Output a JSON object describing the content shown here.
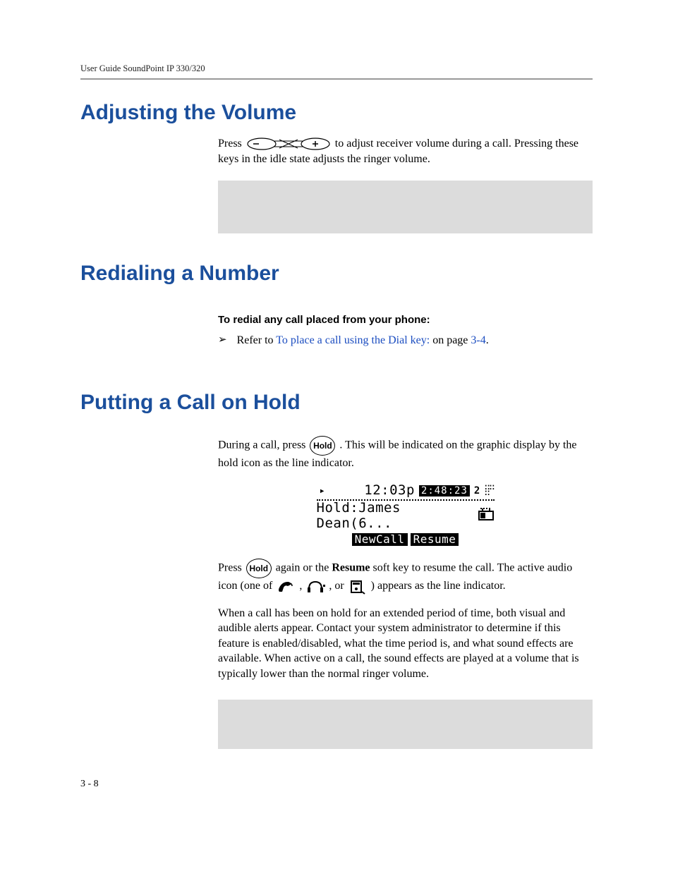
{
  "header": {
    "guide_title": "User Guide SoundPoint IP 330/320"
  },
  "sections": {
    "adjusting_volume": {
      "title": "Adjusting the Volume",
      "p1a": "Press ",
      "p1b": " to adjust receiver volume during a call. Pressing these keys in the idle state adjusts the ringer volume."
    },
    "redialing": {
      "title": "Redialing a Number",
      "subhead": "To redial any call placed from your phone:",
      "bullet_pre": "Refer to ",
      "bullet_link": "To place a call using the Dial key:",
      "bullet_mid": " on page ",
      "bullet_page": "3-4",
      "bullet_post": "."
    },
    "hold": {
      "title": "Putting a Call on Hold",
      "p1a": "During a call, press ",
      "hold_label": "Hold",
      "p1b": ". This will be indicated on the graphic display by the hold icon as the line indicator.",
      "lcd": {
        "time": "12:03p",
        "timer": "2:48:23",
        "line_num": "2",
        "mid_text": "Hold:James Dean(6...",
        "soft1": "NewCall",
        "soft2": "Resume"
      },
      "p2a": "Press ",
      "p2b": " again or the ",
      "resume_bold": "Resume",
      "p2c": " soft key to resume the call. The active audio icon (one of ",
      "p2d": " , ",
      "p2e": " , or ",
      "p2f": " ) appears as the line indicator.",
      "p3": "When a call has been on hold for an extended period of time, both visual and audible alerts appear. Contact your system administrator to determine if this feature is enabled/disabled, what the time period is, and what sound effects are available. When active on a call, the sound effects are played at a volume that is typically lower than the normal ringer volume."
    }
  },
  "footer": {
    "page_number": "3 - 8"
  }
}
